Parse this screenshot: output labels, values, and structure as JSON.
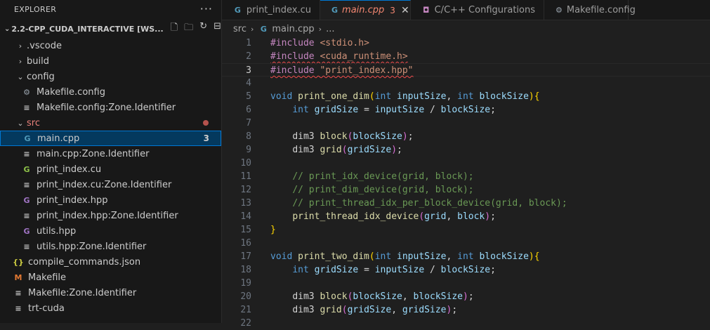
{
  "explorer": {
    "title": "EXPLORER",
    "more_label": "···",
    "workspace_title": "2.2-CPP_CUDA_INTERACTIVE [WS...",
    "actions": [
      "new-file",
      "new-folder",
      "refresh",
      "collapse-all"
    ]
  },
  "tree": [
    {
      "label": ".vscode",
      "type": "folder",
      "expanded": false
    },
    {
      "label": "build",
      "type": "folder",
      "expanded": false
    },
    {
      "label": "config",
      "type": "folder",
      "expanded": true
    },
    {
      "label": "Makefile.config",
      "type": "gear-file"
    },
    {
      "label": "Makefile.config:Zone.Identifier",
      "type": "text-file"
    },
    {
      "label": "src",
      "type": "folder",
      "expanded": true,
      "modified": true
    },
    {
      "label": "main.cpp",
      "type": "cpp-file",
      "badge": "3",
      "selected": true
    },
    {
      "label": "main.cpp:Zone.Identifier",
      "type": "text-file"
    },
    {
      "label": "print_index.cu",
      "type": "cu-file"
    },
    {
      "label": "print_index.cu:Zone.Identifier",
      "type": "text-file"
    },
    {
      "label": "print_index.hpp",
      "type": "hpp-file"
    },
    {
      "label": "print_index.hpp:Zone.Identifier",
      "type": "text-file"
    },
    {
      "label": "utils.hpp",
      "type": "hpp-file"
    },
    {
      "label": "utils.hpp:Zone.Identifier",
      "type": "text-file"
    },
    {
      "label": "compile_commands.json",
      "type": "json-file"
    },
    {
      "label": "Makefile",
      "type": "makefile"
    },
    {
      "label": "Makefile:Zone.Identifier",
      "type": "text-file"
    },
    {
      "label": "trt-cuda",
      "type": "text-file"
    }
  ],
  "tabs": [
    {
      "label": "print_index.cu",
      "icon": "cu-file-icon"
    },
    {
      "label": "main.cpp",
      "icon": "cpp-file-icon",
      "badge": "3",
      "active": true
    },
    {
      "label": "C/C++ Configurations",
      "icon": "config-icon"
    },
    {
      "label": "Makefile.config",
      "icon": "gear-icon"
    }
  ],
  "breadcrumb": {
    "folder": "src",
    "file": "main.cpp",
    "more": "..."
  },
  "editor": {
    "current_line": 3,
    "lines": [
      {
        "n": "1",
        "tokens": [
          [
            "kw-pp",
            "#include "
          ],
          [
            "str",
            "<stdio.h>"
          ]
        ]
      },
      {
        "n": "2",
        "tokens": [
          [
            "kw-pp squig",
            "#include "
          ],
          [
            "str squig",
            "<cuda_runtime.h>"
          ]
        ]
      },
      {
        "n": "3",
        "tokens": [
          [
            "kw-pp squig",
            "#include "
          ],
          [
            "str squig",
            "\"print_index.hpp\""
          ]
        ]
      },
      {
        "n": "4",
        "tokens": []
      },
      {
        "n": "5",
        "tokens": [
          [
            "kw",
            "void "
          ],
          [
            "fn",
            "print_one_dim"
          ],
          [
            "br1",
            "("
          ],
          [
            "kw",
            "int "
          ],
          [
            "var",
            "inputSize"
          ],
          [
            "plain",
            ", "
          ],
          [
            "kw",
            "int "
          ],
          [
            "var",
            "blockSize"
          ],
          [
            "br1",
            ")"
          ],
          [
            "br1",
            "{"
          ]
        ]
      },
      {
        "n": "6",
        "tokens": [
          [
            "plain",
            "    "
          ],
          [
            "kw",
            "int "
          ],
          [
            "var",
            "gridSize"
          ],
          [
            "plain",
            " = "
          ],
          [
            "var",
            "inputSize"
          ],
          [
            "plain",
            " / "
          ],
          [
            "var",
            "blockSize"
          ],
          [
            "plain",
            ";"
          ]
        ]
      },
      {
        "n": "7",
        "tokens": []
      },
      {
        "n": "8",
        "tokens": [
          [
            "plain",
            "    "
          ],
          [
            "plain",
            "dim3 "
          ],
          [
            "fn",
            "block"
          ],
          [
            "br2",
            "("
          ],
          [
            "var",
            "blockSize"
          ],
          [
            "br2",
            ")"
          ],
          [
            "plain",
            ";"
          ]
        ]
      },
      {
        "n": "9",
        "tokens": [
          [
            "plain",
            "    "
          ],
          [
            "plain",
            "dim3 "
          ],
          [
            "fn",
            "grid"
          ],
          [
            "br2",
            "("
          ],
          [
            "var",
            "gridSize"
          ],
          [
            "br2",
            ")"
          ],
          [
            "plain",
            ";"
          ]
        ]
      },
      {
        "n": "10",
        "tokens": []
      },
      {
        "n": "11",
        "tokens": [
          [
            "plain",
            "    "
          ],
          [
            "cm",
            "// print_idx_device(grid, block);"
          ]
        ]
      },
      {
        "n": "12",
        "tokens": [
          [
            "plain",
            "    "
          ],
          [
            "cm",
            "// print_dim_device(grid, block);"
          ]
        ]
      },
      {
        "n": "13",
        "tokens": [
          [
            "plain",
            "    "
          ],
          [
            "cm",
            "// print_thread_idx_per_block_device(grid, block);"
          ]
        ]
      },
      {
        "n": "14",
        "tokens": [
          [
            "plain",
            "    "
          ],
          [
            "fn",
            "print_thread_idx_device"
          ],
          [
            "br2",
            "("
          ],
          [
            "var",
            "grid"
          ],
          [
            "plain",
            ", "
          ],
          [
            "var",
            "block"
          ],
          [
            "br2",
            ")"
          ],
          [
            "plain",
            ";"
          ]
        ]
      },
      {
        "n": "15",
        "tokens": [
          [
            "br1",
            "}"
          ]
        ]
      },
      {
        "n": "16",
        "tokens": []
      },
      {
        "n": "17",
        "tokens": [
          [
            "kw",
            "void "
          ],
          [
            "fn",
            "print_two_dim"
          ],
          [
            "br1",
            "("
          ],
          [
            "kw",
            "int "
          ],
          [
            "var",
            "inputSize"
          ],
          [
            "plain",
            ", "
          ],
          [
            "kw",
            "int "
          ],
          [
            "var",
            "blockSize"
          ],
          [
            "br1",
            ")"
          ],
          [
            "br1",
            "{"
          ]
        ]
      },
      {
        "n": "18",
        "tokens": [
          [
            "plain",
            "    "
          ],
          [
            "kw",
            "int "
          ],
          [
            "var",
            "gridSize"
          ],
          [
            "plain",
            " = "
          ],
          [
            "var",
            "inputSize"
          ],
          [
            "plain",
            " / "
          ],
          [
            "var",
            "blockSize"
          ],
          [
            "plain",
            ";"
          ]
        ]
      },
      {
        "n": "19",
        "tokens": []
      },
      {
        "n": "20",
        "tokens": [
          [
            "plain",
            "    "
          ],
          [
            "plain",
            "dim3 "
          ],
          [
            "fn",
            "block"
          ],
          [
            "br2",
            "("
          ],
          [
            "var",
            "blockSize"
          ],
          [
            "plain",
            ", "
          ],
          [
            "var",
            "blockSize"
          ],
          [
            "br2",
            ")"
          ],
          [
            "plain",
            ";"
          ]
        ]
      },
      {
        "n": "21",
        "tokens": [
          [
            "plain",
            "    "
          ],
          [
            "plain",
            "dim3 "
          ],
          [
            "fn",
            "grid"
          ],
          [
            "br2",
            "("
          ],
          [
            "var",
            "gridSize"
          ],
          [
            "plain",
            ", "
          ],
          [
            "var",
            "gridSize"
          ],
          [
            "br2",
            ")"
          ],
          [
            "plain",
            ";"
          ]
        ]
      },
      {
        "n": "22",
        "tokens": []
      }
    ]
  },
  "colors": {
    "accent": "#0078d4",
    "error": "#f14c4c",
    "modified_dot": "#b5524d"
  }
}
